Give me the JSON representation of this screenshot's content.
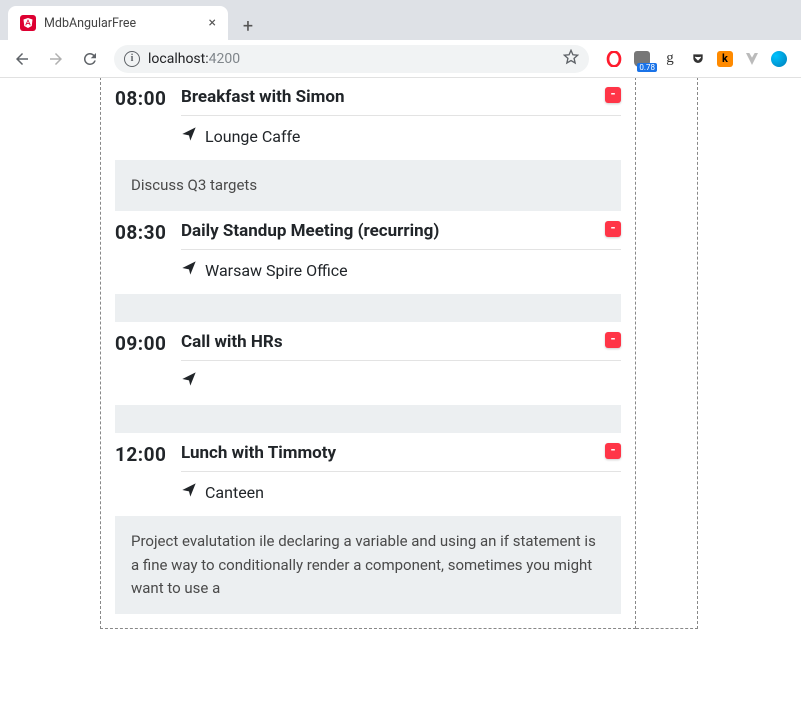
{
  "browser": {
    "tab_title": "MdbAngularFree",
    "url_host": "localhost:",
    "url_port": "4200",
    "ublock_badge": "0.78"
  },
  "events": [
    {
      "time": "08:00",
      "title": "Breakfast with Simon",
      "location": "Lounge Caffe",
      "note": "Discuss Q3 targets"
    },
    {
      "time": "08:30",
      "title": "Daily Standup Meeting (recurring)",
      "location": "Warsaw Spire Office",
      "note": ""
    },
    {
      "time": "09:00",
      "title": "Call with HRs",
      "location": "",
      "note": ""
    },
    {
      "time": "12:00",
      "title": "Lunch with Timmoty",
      "location": "Canteen",
      "note": "Project evalutation ile declaring a variable and using an if statement is a fine way to conditionally render a component, sometimes you might want to use a"
    }
  ]
}
